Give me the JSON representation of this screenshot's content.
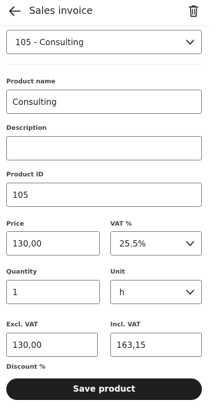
{
  "header": {
    "title": "Sales invoice",
    "back_icon": "arrow-left-icon",
    "delete_icon": "trash-icon"
  },
  "form": {
    "product_select": {
      "value": "105 - Consulting"
    },
    "product_name": {
      "label": "Product name",
      "value": "Consulting"
    },
    "description": {
      "label": "Description",
      "value": ""
    },
    "product_id": {
      "label": "Product ID",
      "value": "105"
    },
    "price": {
      "label": "Price",
      "value": "130,00"
    },
    "vat": {
      "label": "VAT %",
      "value": "25.5%"
    },
    "quantity": {
      "label": "Quantity",
      "value": "1"
    },
    "unit": {
      "label": "Unit",
      "value": "h"
    },
    "excl_vat": {
      "label": "Excl. VAT",
      "value": "130,00"
    },
    "incl_vat": {
      "label": "Incl. VAT",
      "value": "163,15"
    },
    "discount": {
      "label": "Discount %"
    }
  },
  "footer": {
    "save_label": "Save product"
  },
  "colors": {
    "button_bg": "#1f1f1f",
    "border": "#8a8a8a",
    "text": "#222222"
  }
}
